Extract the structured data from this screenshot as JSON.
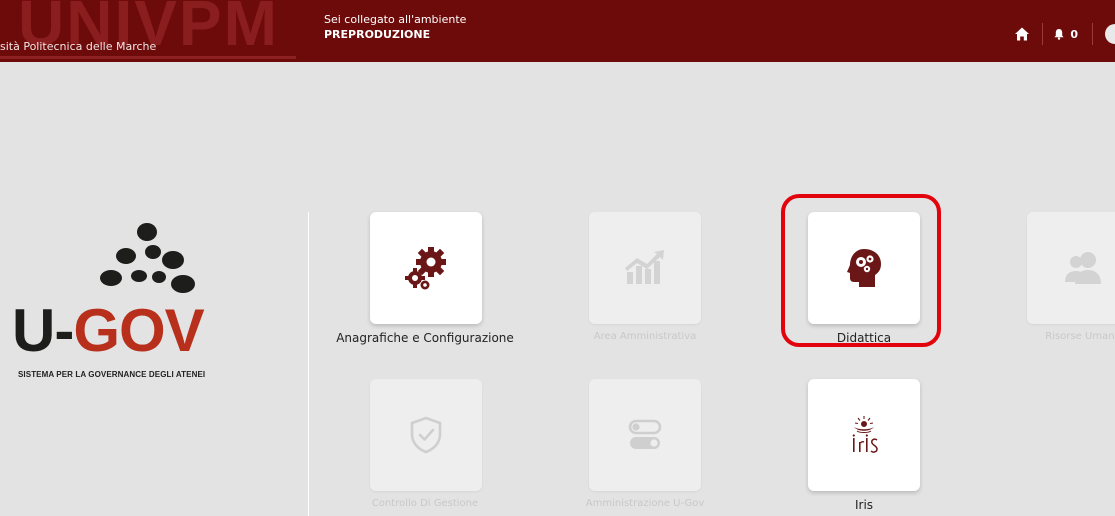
{
  "header": {
    "brand_watermark": "UNIVPM",
    "brand_name": "sità Politecnica delle Marche",
    "environment_label": "Sei collegato all'ambiente",
    "environment_value": "PREPRODUZIONE",
    "notification_count": "0"
  },
  "logo": {
    "u": "U-",
    "gov": "GOV",
    "tagline": "SISTEMA PER LA GOVERNANCE DEGLI ATENEI"
  },
  "tiles": [
    {
      "label": "Anagrafiche e Configurazione",
      "icon": "gears-icon",
      "enabled": true
    },
    {
      "label": "Area Amministrativa",
      "icon": "bar-chart-icon",
      "enabled": false
    },
    {
      "label": "Didattica",
      "icon": "head-gears-icon",
      "enabled": true,
      "highlighted": true
    },
    {
      "label": "Risorse Umane",
      "icon": "users-icon",
      "enabled": false
    },
    {
      "label": "Controllo Di Gestione",
      "icon": "shield-check-icon",
      "enabled": false
    },
    {
      "label": "Amministrazione U-Gov",
      "icon": "toggles-icon",
      "enabled": false
    },
    {
      "label": "Iris",
      "icon": "iris-logo-icon",
      "enabled": true
    }
  ],
  "colors": {
    "header_bg": "#6d0a0a",
    "accent": "#6b1717",
    "highlight": "#e3030c",
    "background": "#e3e3e3"
  }
}
